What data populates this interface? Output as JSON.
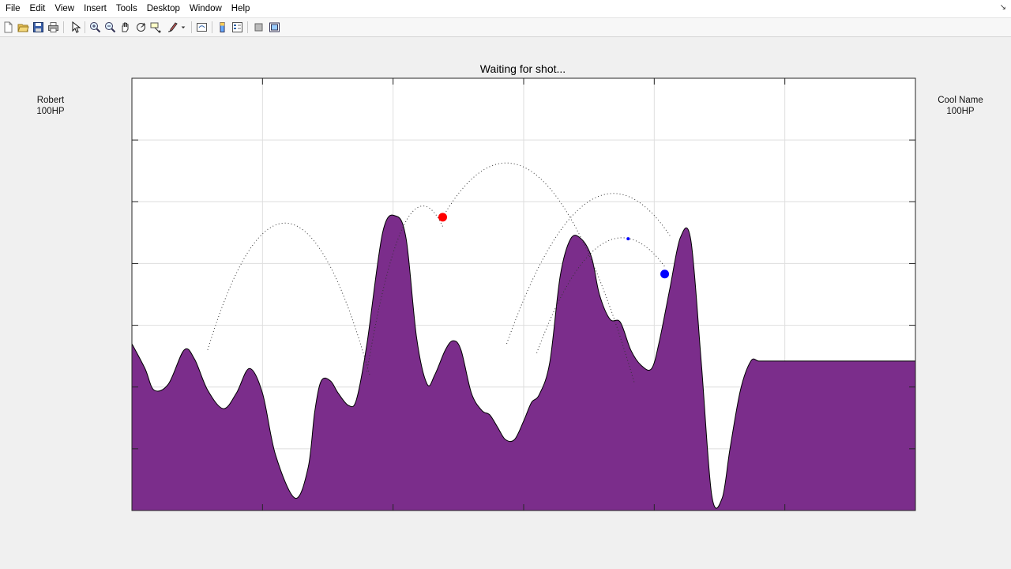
{
  "menu": {
    "items": [
      "File",
      "Edit",
      "View",
      "Insert",
      "Tools",
      "Desktop",
      "Window",
      "Help"
    ]
  },
  "toolbar": {
    "buttons": [
      {
        "name": "new-figure-icon"
      },
      {
        "name": "open-file-icon"
      },
      {
        "name": "save-icon"
      },
      {
        "name": "print-icon"
      },
      {
        "name": "edit-plot-arrow-icon"
      },
      {
        "name": "zoom-in-icon"
      },
      {
        "name": "zoom-out-icon"
      },
      {
        "name": "pan-hand-icon"
      },
      {
        "name": "rotate-3d-icon"
      },
      {
        "name": "data-cursor-icon"
      },
      {
        "name": "brush-icon"
      },
      {
        "name": "link-plot-icon"
      },
      {
        "name": "colorbar-icon"
      },
      {
        "name": "legend-icon"
      },
      {
        "name": "hide-plot-tools-icon"
      },
      {
        "name": "show-plot-tools-icon"
      }
    ]
  },
  "game": {
    "status": "Waiting for shot...",
    "player_left": {
      "name": "Robert",
      "hp": "100HP",
      "color": "#ff0000"
    },
    "player_right": {
      "name": "Cool Name",
      "hp": "100HP",
      "color": "#0000ff"
    },
    "terrain_color": "#7b2d8b",
    "grid": true
  },
  "chart_data": {
    "type": "area",
    "xlim": [
      0,
      6
    ],
    "ylim": [
      0,
      7
    ],
    "terrain": {
      "x": [
        0,
        0.1,
        0.17,
        0.28,
        0.4,
        0.48,
        0.58,
        0.7,
        0.8,
        0.9,
        1.0,
        1.1,
        1.25,
        1.35,
        1.4,
        1.45,
        1.52,
        1.58,
        1.66,
        1.72,
        1.8,
        1.92,
        2.02,
        2.1,
        2.18,
        2.26,
        2.32,
        2.4,
        2.46,
        2.52,
        2.6,
        2.68,
        2.74,
        2.8,
        2.86,
        2.93,
        3.0,
        3.06,
        3.12,
        3.2,
        3.28,
        3.36,
        3.44,
        3.52,
        3.58,
        3.66,
        3.74,
        3.82,
        3.9,
        3.98,
        4.04,
        4.12,
        4.2,
        4.28,
        4.36,
        4.44,
        4.52,
        4.58,
        4.66,
        4.74,
        4.8,
        4.88,
        4.96,
        5.04,
        5.12,
        5.2,
        5.26,
        5.32,
        5.38,
        5.44,
        5.52,
        5.58,
        5.64,
        6.0
      ],
      "y": [
        2.7,
        2.3,
        1.95,
        2.05,
        2.6,
        2.45,
        1.95,
        1.65,
        1.9,
        2.3,
        1.9,
        0.9,
        0.2,
        0.7,
        1.6,
        2.1,
        2.1,
        1.9,
        1.7,
        1.8,
        2.7,
        4.5,
        4.77,
        4.4,
        2.8,
        2.05,
        2.2,
        2.6,
        2.75,
        2.6,
        1.9,
        1.62,
        1.55,
        1.35,
        1.15,
        1.15,
        1.45,
        1.75,
        1.88,
        2.4,
        3.8,
        4.4,
        4.4,
        4.1,
        3.5,
        3.1,
        3.05,
        2.6,
        2.35,
        2.3,
        2.75,
        3.6,
        4.42,
        4.38,
        2.4,
        0.25,
        0.2,
        1.0,
        1.95,
        2.42,
        2.42,
        2.42,
        2.42,
        2.42,
        2.42,
        2.42,
        2.42,
        2.42,
        2.42,
        2.42,
        2.42,
        2.42,
        2.42,
        2.42
      ]
    },
    "tanks": [
      {
        "name": "Robert",
        "x": 2.38,
        "y": 4.75,
        "color": "#ff0000"
      },
      {
        "name": "Cool Name",
        "x": 4.08,
        "y": 3.83,
        "color": "#0000ff"
      }
    ],
    "projectile": {
      "x": 3.8,
      "y": 4.4,
      "color": "#0000ff"
    },
    "trajectories": [
      {
        "from": [
          0.58,
          2.6
        ],
        "to": [
          1.82,
          2.2
        ],
        "apex_y": 4.65
      },
      {
        "from": [
          1.8,
          2.25
        ],
        "to": [
          2.38,
          4.6
        ],
        "apex_y": 4.65
      },
      {
        "from": [
          2.38,
          4.75
        ],
        "to": [
          3.85,
          2.05
        ],
        "apex_y": 5.4
      },
      {
        "from": [
          2.87,
          2.7
        ],
        "to": [
          4.12,
          4.45
        ],
        "apex_y": 5.0
      },
      {
        "from": [
          3.1,
          2.55
        ],
        "to": [
          4.08,
          3.95
        ],
        "apex_y": 4.3
      }
    ]
  }
}
